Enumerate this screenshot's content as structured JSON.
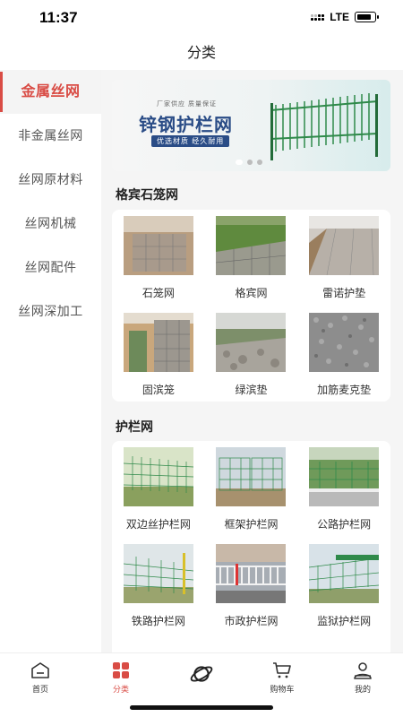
{
  "status_bar": {
    "time": "11:37",
    "network": "LTE"
  },
  "header": {
    "title": "分类"
  },
  "sidebar": {
    "items": [
      {
        "label": "金属丝网",
        "active": true
      },
      {
        "label": "非金属丝网",
        "active": false
      },
      {
        "label": "丝网原材料",
        "active": false
      },
      {
        "label": "丝网机械",
        "active": false
      },
      {
        "label": "丝网配件",
        "active": false
      },
      {
        "label": "丝网深加工",
        "active": false
      }
    ]
  },
  "banner": {
    "subtitle": "厂家供应  质量保证",
    "title": "锌钢护栏网",
    "tagline": "优选材质  经久耐用",
    "slide_count": 3,
    "active_slide": 1
  },
  "sections": [
    {
      "title": "格宾石笼网",
      "items": [
        {
          "label": "石笼网",
          "icon": "gabion-photo"
        },
        {
          "label": "格宾网",
          "icon": "gabion-slope-photo"
        },
        {
          "label": "雷诺护垫",
          "icon": "reno-mattress-photo"
        },
        {
          "label": "固滨笼",
          "icon": "gabion-wall-photo"
        },
        {
          "label": "绿滨垫",
          "icon": "green-mattress-photo"
        },
        {
          "label": "加筋麦克垫",
          "icon": "mesh-mat-photo"
        }
      ]
    },
    {
      "title": "护栏网",
      "items": [
        {
          "label": "双边丝护栏网",
          "icon": "fence-photo"
        },
        {
          "label": "框架护栏网",
          "icon": "fence-photo"
        },
        {
          "label": "公路护栏网",
          "icon": "fence-photo"
        },
        {
          "label": "铁路护栏网",
          "icon": "fence-photo"
        },
        {
          "label": "市政护栏网",
          "icon": "railing-photo"
        },
        {
          "label": "监狱护栏网",
          "icon": "fence-photo"
        }
      ]
    }
  ],
  "tabbar": {
    "items": [
      {
        "label": "首页",
        "icon": "home-icon",
        "active": false
      },
      {
        "label": "分类",
        "icon": "category-icon",
        "active": true
      },
      {
        "label": "",
        "icon": "planet-icon",
        "active": false
      },
      {
        "label": "购物车",
        "icon": "cart-icon",
        "active": false
      },
      {
        "label": "我的",
        "icon": "user-icon",
        "active": false
      }
    ]
  },
  "colors": {
    "accent": "#d94c45",
    "banner_title": "#2a4c86",
    "fence_green": "#2f8a4a"
  }
}
